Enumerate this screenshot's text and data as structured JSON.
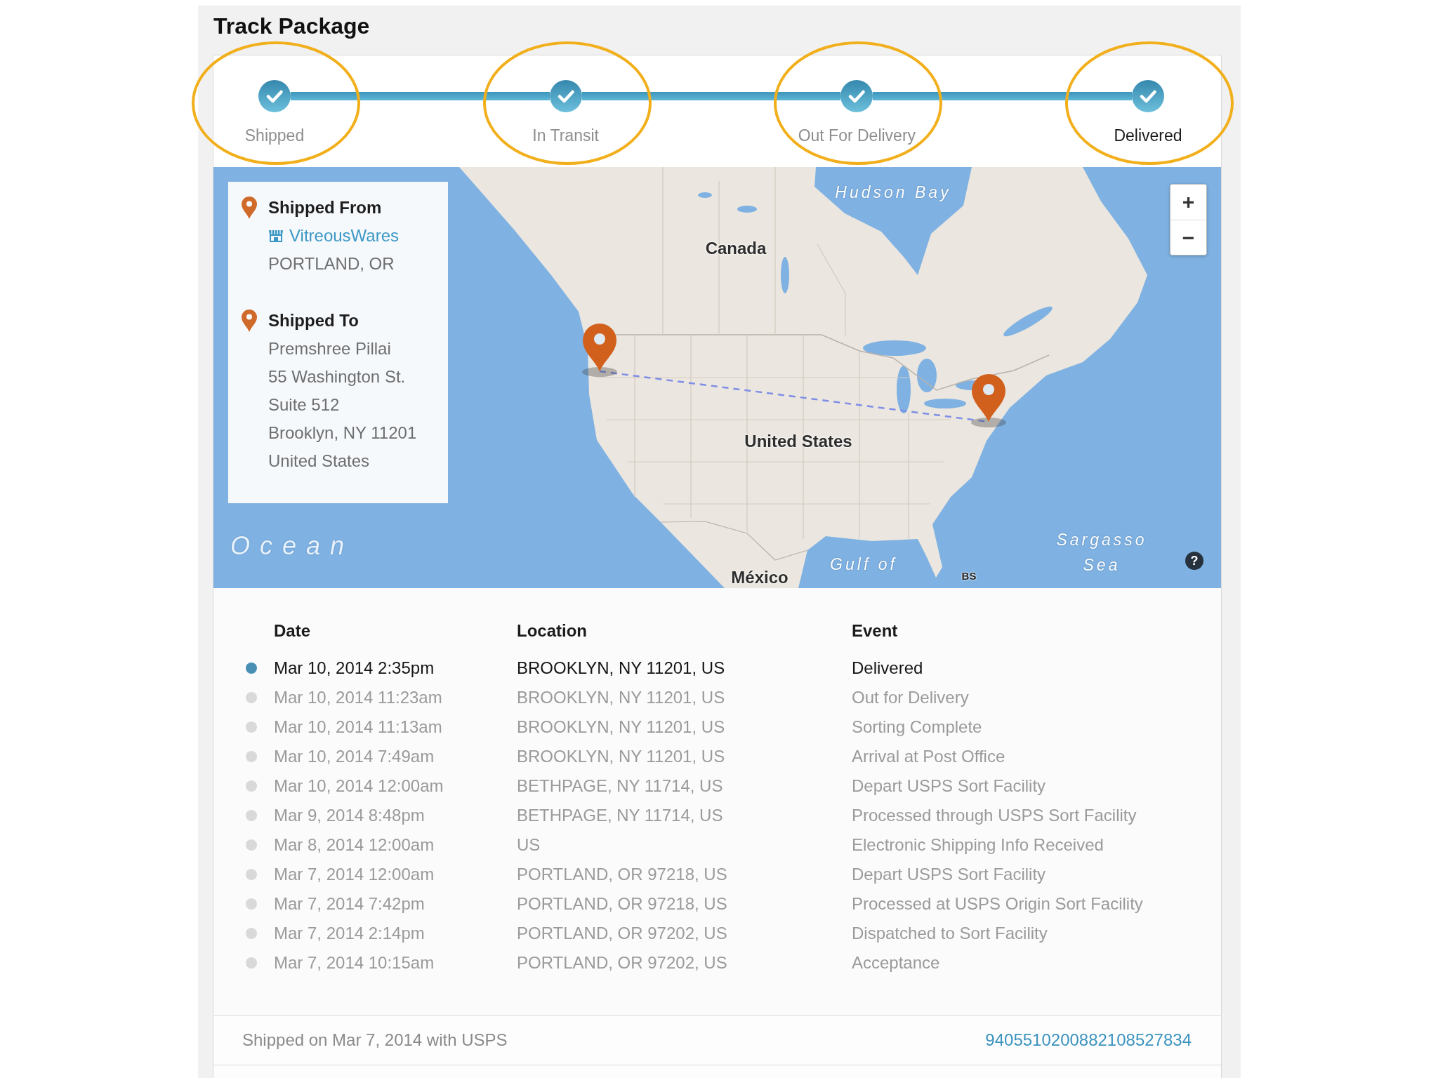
{
  "page": {
    "title": "Track Package"
  },
  "progress": {
    "steps": [
      {
        "label": "Shipped",
        "done": true,
        "current": false,
        "highlighted": true
      },
      {
        "label": "In Transit",
        "done": true,
        "current": false,
        "highlighted": true
      },
      {
        "label": "Out For Delivery",
        "done": true,
        "current": false,
        "highlighted": true
      },
      {
        "label": "Delivered",
        "done": true,
        "current": true,
        "highlighted": true
      }
    ]
  },
  "map": {
    "addresses": [
      {
        "heading": "Shipped From",
        "link": "VitreousWares",
        "lines": [
          "PORTLAND, OR"
        ]
      },
      {
        "heading": "Shipped To",
        "lines": [
          "Premshree Pillai",
          "55 Washington St.",
          "Suite 512",
          "Brooklyn, NY 11201",
          "United States"
        ]
      }
    ],
    "labels": [
      {
        "text": "Hudson Bay",
        "kind": "water"
      },
      {
        "text": "Canada",
        "kind": "country"
      },
      {
        "text": "United States",
        "kind": "country"
      },
      {
        "text": "Ocean",
        "kind": "ocean"
      },
      {
        "text": "México",
        "kind": "country"
      },
      {
        "text": "Gulf of",
        "kind": "water"
      },
      {
        "text": "BS",
        "kind": "abbreviation"
      },
      {
        "text": "Sargasso Sea",
        "kind": "water"
      }
    ],
    "zoom_in": "+",
    "zoom_out": "−",
    "help": "?"
  },
  "events": {
    "columns": [
      "Date",
      "Location",
      "Event"
    ],
    "rows": [
      {
        "date": "Mar 10, 2014 2:35pm",
        "location": "BROOKLYN, NY 11201, US",
        "event": "Delivered",
        "current": true
      },
      {
        "date": "Mar 10, 2014 11:23am",
        "location": "BROOKLYN, NY 11201, US",
        "event": "Out for Delivery",
        "current": false
      },
      {
        "date": "Mar 10, 2014 11:13am",
        "location": "BROOKLYN, NY 11201, US",
        "event": "Sorting Complete",
        "current": false
      },
      {
        "date": "Mar 10, 2014 7:49am",
        "location": "BROOKLYN, NY 11201, US",
        "event": "Arrival at Post Office",
        "current": false
      },
      {
        "date": "Mar 10, 2014 12:00am",
        "location": "BETHPAGE, NY 11714, US",
        "event": "Depart USPS Sort Facility",
        "current": false
      },
      {
        "date": "Mar 9, 2014 8:48pm",
        "location": "BETHPAGE, NY 11714, US",
        "event": "Processed through USPS Sort Facility",
        "current": false
      },
      {
        "date": "Mar 8, 2014 12:00am",
        "location": "US",
        "event": "Electronic Shipping Info Received",
        "current": false
      },
      {
        "date": "Mar 7, 2014 12:00am",
        "location": "PORTLAND, OR 97218, US",
        "event": "Depart USPS Sort Facility",
        "current": false
      },
      {
        "date": "Mar 7, 2014 7:42pm",
        "location": "PORTLAND, OR 97218, US",
        "event": "Processed at USPS Origin Sort Facility",
        "current": false
      },
      {
        "date": "Mar 7, 2014 2:14pm",
        "location": "PORTLAND, OR 97202, US",
        "event": "Dispatched to Sort Facility",
        "current": false
      },
      {
        "date": "Mar 7, 2014 10:15am",
        "location": "PORTLAND, OR 97202, US",
        "event": "Acceptance",
        "current": false
      }
    ]
  },
  "footer": {
    "note": "Shipped on Mar 7, 2014 with USPS",
    "tracking_number": "9405510200882108527834"
  }
}
